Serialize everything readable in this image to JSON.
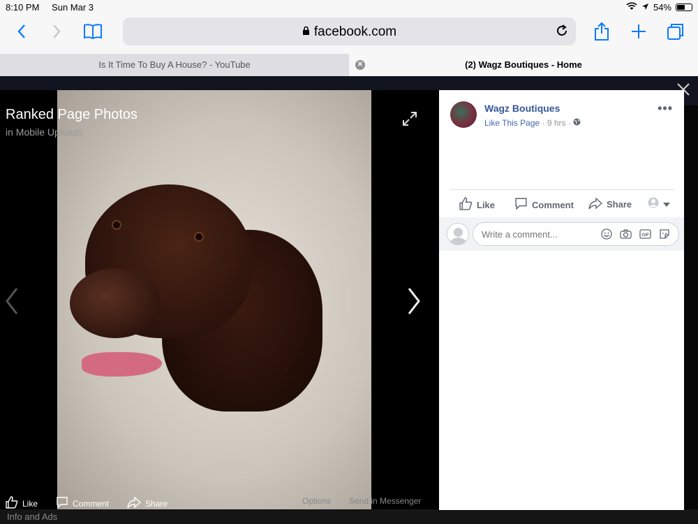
{
  "status": {
    "time": "8:10 PM",
    "date": "Sun Mar 3",
    "battery": "54%",
    "battery_level": 0.54
  },
  "browser": {
    "url": "facebook.com"
  },
  "tabs": [
    {
      "title": "Is It Time To Buy A House? - YouTube"
    },
    {
      "title": "(2) Wagz Boutiques - Home"
    }
  ],
  "photo": {
    "title": "Ranked Page Photos",
    "subtitle": "in Mobile Uploads"
  },
  "photo_actions": {
    "like": "Like",
    "comment": "Comment",
    "share": "Share",
    "options": "Options",
    "send": "Send in Messenger"
  },
  "footer": {
    "info": "Info and Ads"
  },
  "post": {
    "page_name": "Wagz Boutiques",
    "like_page": "Like This Page",
    "time": "9 hrs",
    "actions": {
      "like": "Like",
      "comment": "Comment",
      "share": "Share"
    },
    "comment_placeholder": "Write a comment..."
  }
}
